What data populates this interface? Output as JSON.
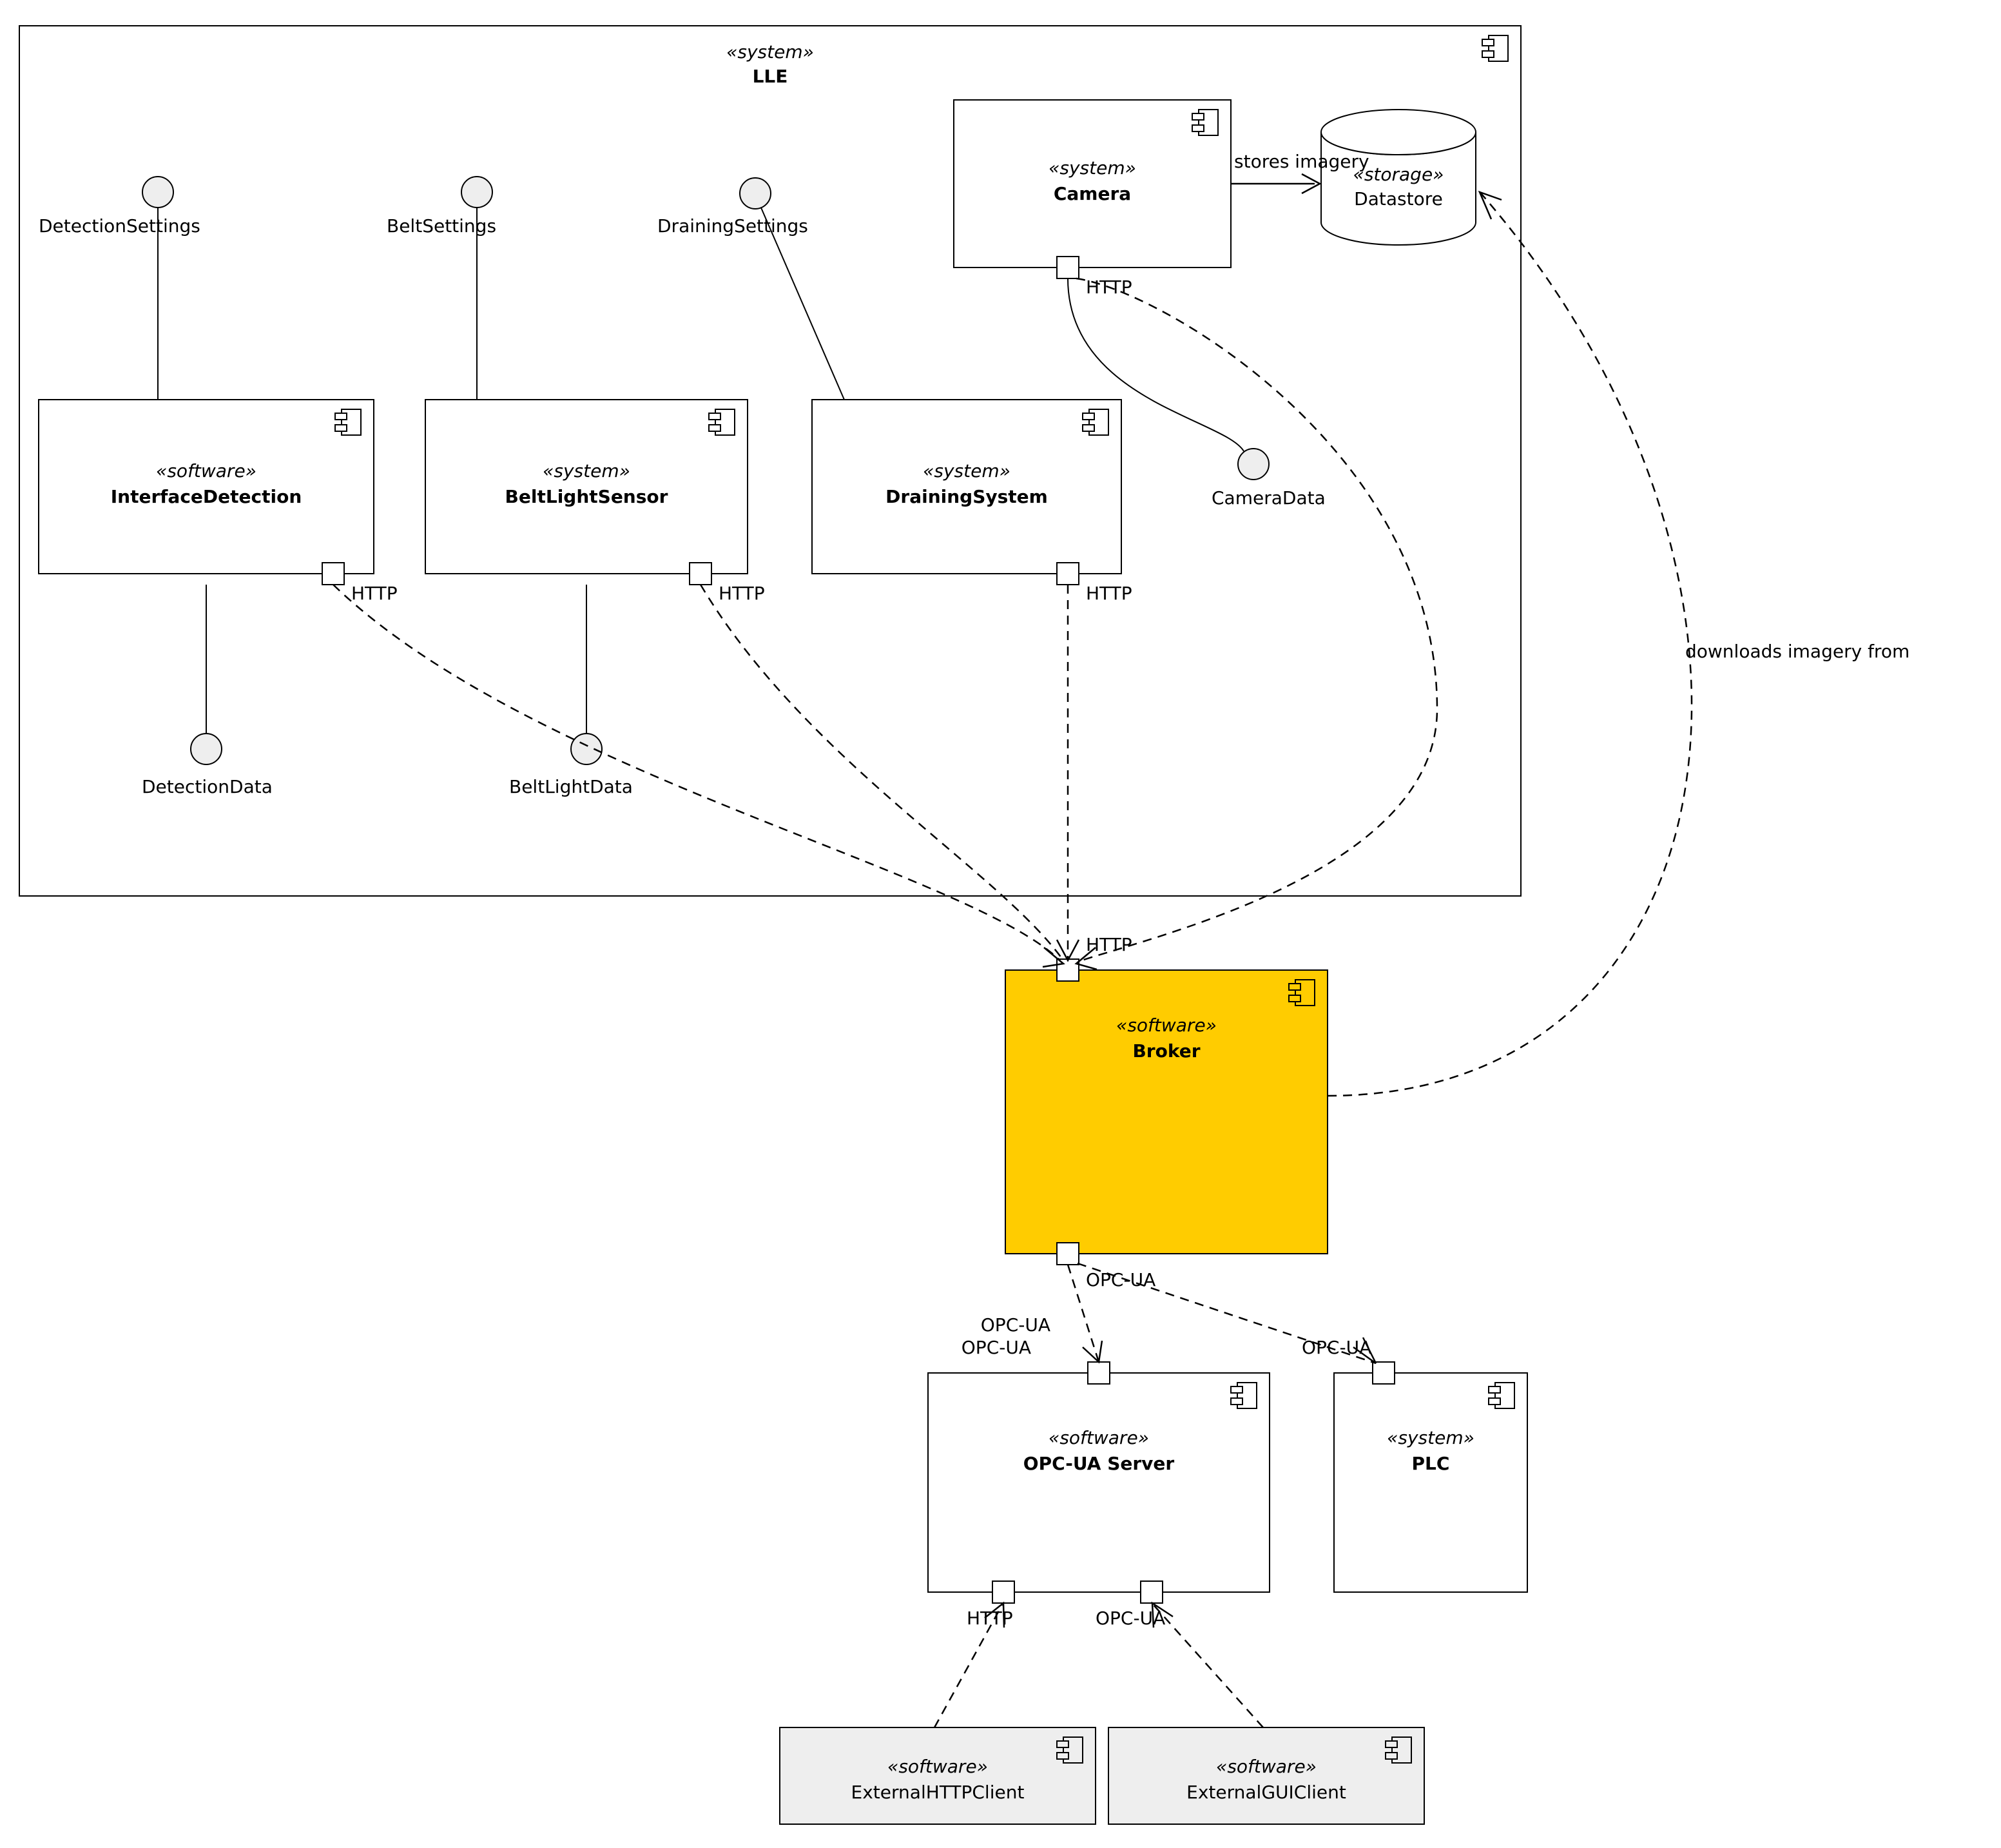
{
  "outer": {
    "stereo": "«system»",
    "name": "LLE"
  },
  "camera": {
    "stereo": "«system»",
    "name": "Camera",
    "port": "HTTP",
    "iface": "CameraData",
    "edge": "stores imagery"
  },
  "datastore": {
    "stereo": "«storage»",
    "name": "Datastore"
  },
  "ifaceDet": {
    "stereo": "«software»",
    "name": "InterfaceDetection",
    "port": "HTTP",
    "top": "DetectionSettings",
    "bottom": "DetectionData"
  },
  "belt": {
    "stereo": "«system»",
    "name": "BeltLightSensor",
    "port": "HTTP",
    "top": "BeltSettings",
    "bottom": "BeltLightData"
  },
  "drain": {
    "stereo": "«system»",
    "name": "DrainingSystem",
    "port": "HTTP",
    "top": "DrainingSettings"
  },
  "broker": {
    "stereo": "«software»",
    "name": "Broker",
    "portTop": "HTTP",
    "portBot": "OPC-UA"
  },
  "opcua": {
    "stereo": "«software»",
    "name": "OPC-UA Server",
    "portTop": "OPC-UA",
    "portBL": "HTTP",
    "portBR": "OPC-UA"
  },
  "plc": {
    "stereo": "«system»",
    "name": "PLC",
    "portTop": "OPC-UA"
  },
  "extHttp": {
    "stereo": "«software»",
    "name": "ExternalHTTPClient"
  },
  "extGui": {
    "stereo": "«software»",
    "name": "ExternalGUIClient"
  },
  "edgeDatastore": "downloads imagery from",
  "edgeOpc": "OPC-UA"
}
